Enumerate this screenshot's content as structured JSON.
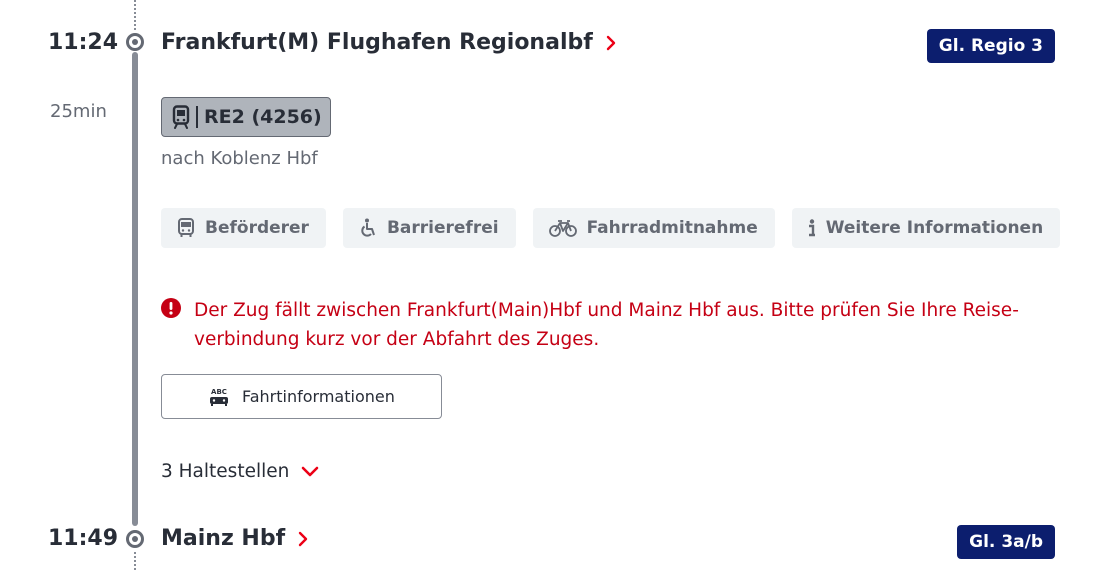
{
  "departure": {
    "time": "11:24",
    "station": "Frankfurt(M) Flughafen Regionalbf",
    "platform": "Gl. Regio 3"
  },
  "duration": "25min",
  "train": {
    "icon": "train-icon",
    "label": "RE2 (4256)",
    "direction": "nach Koblenz Hbf"
  },
  "chips": [
    {
      "label": "Beförderer",
      "icon": "bus-icon"
    },
    {
      "label": "Barrierefrei",
      "icon": "wheelchair-icon"
    },
    {
      "label": "Fahrradmitnahme",
      "icon": "bicycle-icon"
    },
    {
      "label": "Weitere Informationen",
      "icon": "info-icon"
    }
  ],
  "alert": {
    "text": "Der Zug fällt zwischen Frankfurt(Main)Hbf und Mainz Hbf aus. Bitte prüfen Sie Ihre Reise­verbindung kurz vor der Abfahrt des Zuges.",
    "color": "#c50014"
  },
  "info_button": {
    "label": "Fahrtinformationen",
    "icon_text": "ABC"
  },
  "stops_toggle": "3 Haltestellen",
  "arrival": {
    "time": "11:49",
    "station": "Mainz Hbf",
    "platform": "Gl. 3a/b"
  },
  "colors": {
    "accent": "#ec0016",
    "platform_bg": "#0c1e6e",
    "rail": "#878c96"
  }
}
